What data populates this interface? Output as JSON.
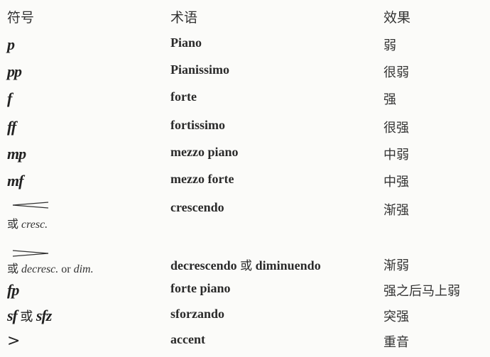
{
  "headers": {
    "symbol": "符号",
    "term": "术语",
    "effect": "效果"
  },
  "rows": [
    {
      "symbol": "p",
      "term": "Piano",
      "effect": "弱"
    },
    {
      "symbol": "pp",
      "term": "Pianissimo",
      "effect": "很弱"
    },
    {
      "symbol": "f",
      "term": "forte",
      "effect": "强"
    },
    {
      "symbol": "ff",
      "term": "fortissimo",
      "effect": "很强"
    },
    {
      "symbol": "mp",
      "term": "mezzo piano",
      "effect": "中弱"
    },
    {
      "symbol": "mf",
      "term": "mezzo forte",
      "effect": "中强"
    },
    {
      "symbol_or": "或",
      "symbol_alt": "cresc.",
      "term": "crescendo",
      "effect": "渐强"
    },
    {
      "symbol_or": "或",
      "symbol_alt": "decresc.",
      "symbol_mid": "or",
      "symbol_alt2": "dim.",
      "term_a": "decrescendo",
      "term_or": "或",
      "term_b": "diminuendo",
      "effect": "渐弱"
    },
    {
      "symbol": "fp",
      "term": "forte piano",
      "effect": "强之后马上弱"
    },
    {
      "symbol_a": "sf",
      "symbol_or": "或",
      "symbol_b": "sfz",
      "term": "sforzando",
      "effect": "突强"
    },
    {
      "symbol": ">",
      "term": "accent",
      "effect": "重音"
    }
  ]
}
